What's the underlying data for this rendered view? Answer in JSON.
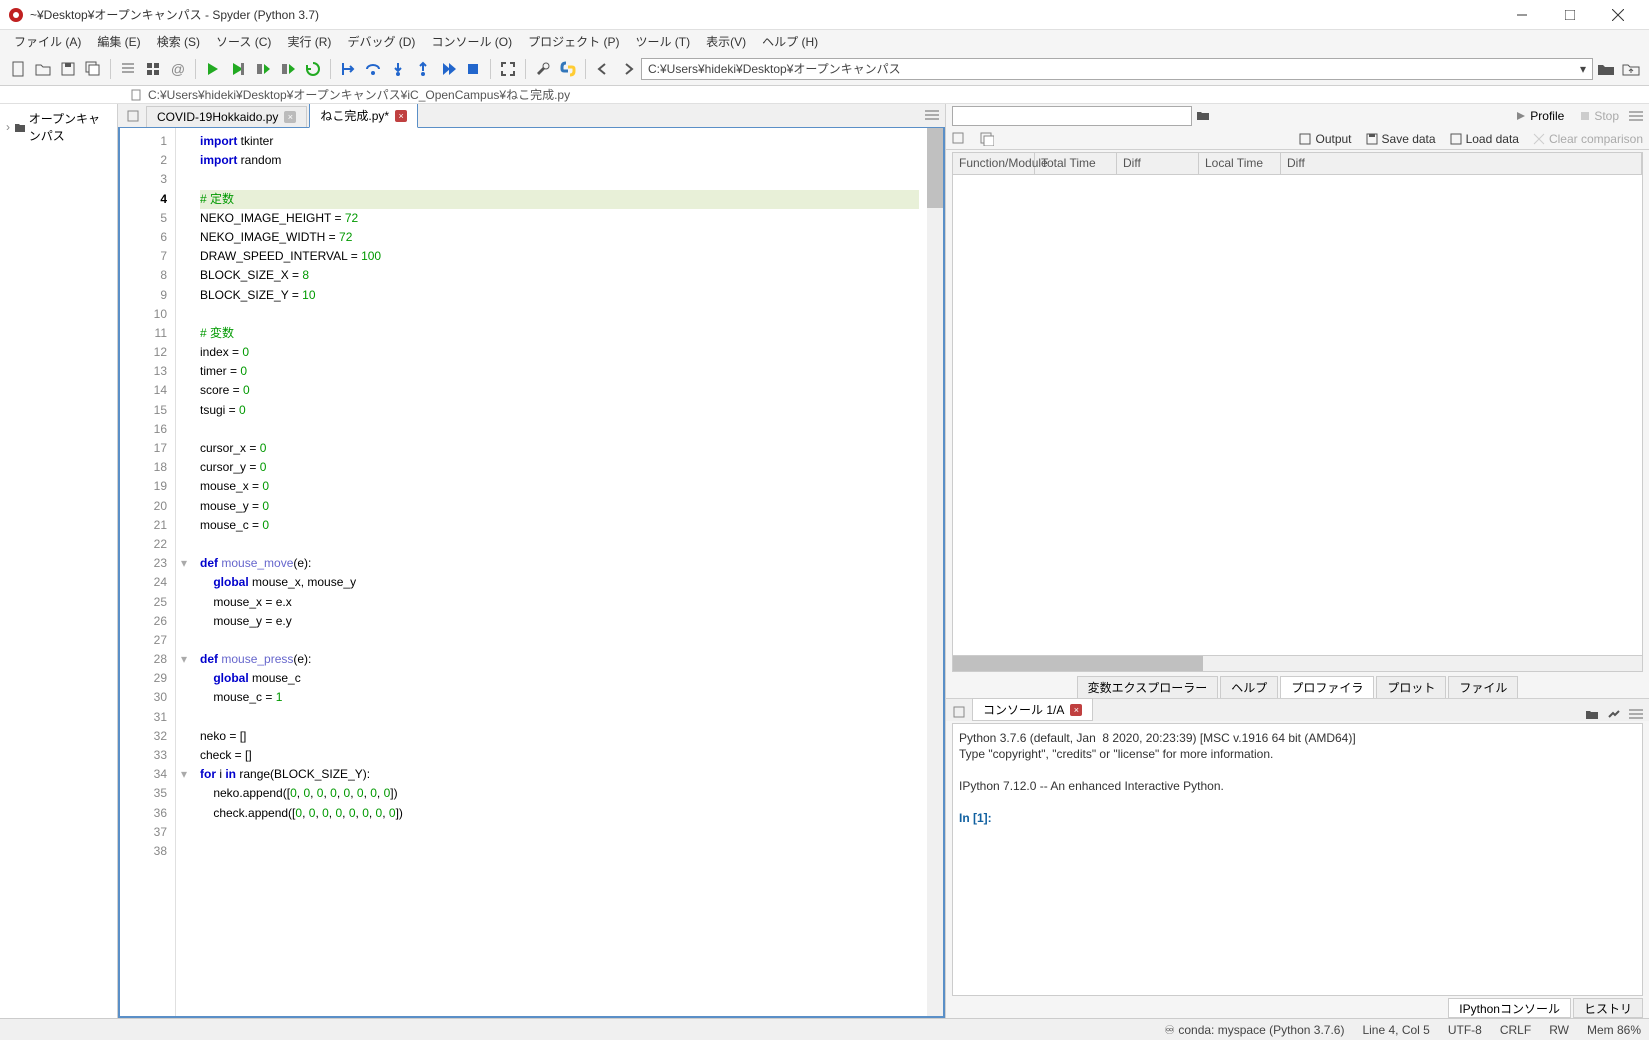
{
  "window": {
    "title": "~¥Desktop¥オープンキャンパス - Spyder (Python 3.7)"
  },
  "menu": {
    "file": "ファイル (A)",
    "edit": "編集 (E)",
    "search": "検索 (S)",
    "source": "ソース (C)",
    "run": "実行 (R)",
    "debug": "デバッグ (D)",
    "console": "コンソール (O)",
    "project": "プロジェクト (P)",
    "tool": "ツール (T)",
    "view": "表示(V)",
    "help": "ヘルプ (H)"
  },
  "toolbar": {
    "path": "C:¥Users¥hideki¥Desktop¥オープンキャンパス"
  },
  "breadcrumb": "C:¥Users¥hideki¥Desktop¥オープンキャンパス¥iC_OpenCampus¥ねこ完成.py",
  "tree": {
    "root": "オープンキャンパス"
  },
  "tabs": {
    "t1": "COVID-19Hokkaido.py",
    "t2": "ねこ完成.py*"
  },
  "code": {
    "lines": [
      {
        "n": 1,
        "html": "<span class='kw'>import</span> tkinter"
      },
      {
        "n": 2,
        "html": "<span class='kw'>import</span> random"
      },
      {
        "n": 3,
        "html": ""
      },
      {
        "n": 4,
        "html": "<span class='cm'># 定数</span>",
        "cur": true
      },
      {
        "n": 5,
        "html": "NEKO_IMAGE_HEIGHT = <span class='num'>72</span>"
      },
      {
        "n": 6,
        "html": "NEKO_IMAGE_WIDTH = <span class='num'>72</span>"
      },
      {
        "n": 7,
        "html": "DRAW_SPEED_INTERVAL = <span class='num'>100</span>"
      },
      {
        "n": 8,
        "html": "BLOCK_SIZE_X = <span class='num'>8</span>"
      },
      {
        "n": 9,
        "html": "BLOCK_SIZE_Y = <span class='num'>10</span>"
      },
      {
        "n": 10,
        "html": ""
      },
      {
        "n": 11,
        "html": "<span class='cm'># 変数</span>"
      },
      {
        "n": 12,
        "html": "index = <span class='num'>0</span>"
      },
      {
        "n": 13,
        "html": "timer = <span class='num'>0</span>"
      },
      {
        "n": 14,
        "html": "score = <span class='num'>0</span>"
      },
      {
        "n": 15,
        "html": "tsugi = <span class='num'>0</span>"
      },
      {
        "n": 16,
        "html": ""
      },
      {
        "n": 17,
        "html": "cursor_x = <span class='num'>0</span>"
      },
      {
        "n": 18,
        "html": "cursor_y = <span class='num'>0</span>"
      },
      {
        "n": 19,
        "html": "mouse_x = <span class='num'>0</span>"
      },
      {
        "n": 20,
        "html": "mouse_y = <span class='num'>0</span>"
      },
      {
        "n": 21,
        "html": "mouse_c = <span class='num'>0</span>"
      },
      {
        "n": 22,
        "html": ""
      },
      {
        "n": 23,
        "html": "<span class='kw'>def</span> <span class='fn'>mouse_move</span>(e):",
        "fold": true
      },
      {
        "n": 24,
        "html": "    <span class='kw'>global</span> mouse_x, mouse_y"
      },
      {
        "n": 25,
        "html": "    mouse_x = e.x"
      },
      {
        "n": 26,
        "html": "    mouse_y = e.y"
      },
      {
        "n": 27,
        "html": ""
      },
      {
        "n": 28,
        "html": "<span class='kw'>def</span> <span class='fn'>mouse_press</span>(e):",
        "fold": true
      },
      {
        "n": 29,
        "html": "    <span class='kw'>global</span> mouse_c"
      },
      {
        "n": 30,
        "html": "    mouse_c = <span class='num'>1</span>"
      },
      {
        "n": 31,
        "html": ""
      },
      {
        "n": 32,
        "html": "neko = []"
      },
      {
        "n": 33,
        "html": "check = []"
      },
      {
        "n": 34,
        "html": "<span class='kw'>for</span> i <span class='kw'>in</span> range(BLOCK_SIZE_Y):",
        "fold": true
      },
      {
        "n": 35,
        "html": "    neko.append([<span class='num'>0</span>, <span class='num'>0</span>, <span class='num'>0</span>, <span class='num'>0</span>, <span class='num'>0</span>, <span class='num'>0</span>, <span class='num'>0</span>, <span class='num'>0</span>])"
      },
      {
        "n": 36,
        "html": "    check.append([<span class='num'>0</span>, <span class='num'>0</span>, <span class='num'>0</span>, <span class='num'>0</span>, <span class='num'>0</span>, <span class='num'>0</span>, <span class='num'>0</span>, <span class='num'>0</span>])"
      },
      {
        "n": 37,
        "html": ""
      },
      {
        "n": 38,
        "html": ""
      }
    ]
  },
  "profiler": {
    "profile": "Profile",
    "stop": "Stop",
    "output": "Output",
    "save": "Save data",
    "load": "Load data",
    "clear": "Clear comparison",
    "col1": "Function/Module",
    "col2": "Total Time",
    "col3": "Diff",
    "col4": "Local Time",
    "col5": "Diff"
  },
  "rp_tabs": {
    "t1": "変数エクスプローラー",
    "t2": "ヘルプ",
    "t3": "プロファイラ",
    "t4": "プロット",
    "t5": "ファイル"
  },
  "console": {
    "tab": "コンソール 1/A",
    "text1": "Python 3.7.6 (default, Jan  8 2020, 20:23:39) [MSC v.1916 64 bit (AMD64)]",
    "text2": "Type \"copyright\", \"credits\" or \"license\" for more information.",
    "text3": "IPython 7.12.0 -- An enhanced Interactive Python.",
    "prompt": "In [1]:",
    "btab1": "IPythonコンソール",
    "btab2": "ヒストリ"
  },
  "status": {
    "conda": "conda: myspace (Python 3.7.6)",
    "pos": "Line 4, Col 5",
    "enc": "UTF-8",
    "eol": "CRLF",
    "rw": "RW",
    "mem": "Mem 86%"
  }
}
